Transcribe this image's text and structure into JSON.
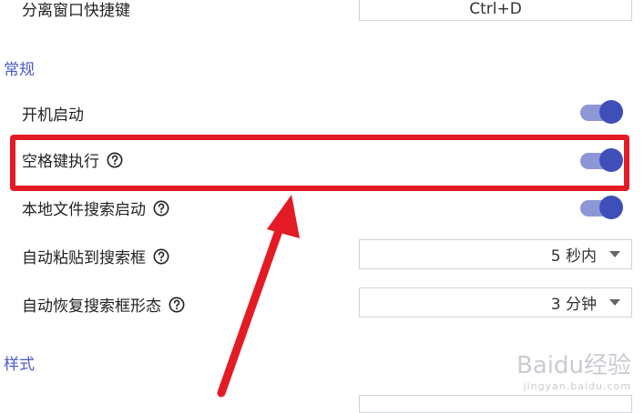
{
  "hotkey_row": {
    "label": "分离窗口快捷键",
    "value": "Ctrl+D"
  },
  "general": {
    "title": "常规",
    "rows": [
      {
        "label": "开机启动",
        "toggle": true
      },
      {
        "label": "空格键执行",
        "toggle": true,
        "help": true,
        "highlighted": true
      },
      {
        "label": "本地文件搜索启动",
        "toggle": true,
        "help": true
      },
      {
        "label": "自动粘贴到搜索框",
        "select_value": "5 秒内",
        "help": true
      },
      {
        "label": "自动恢复搜索框形态",
        "select_value": "3 分钟",
        "help": true
      }
    ]
  },
  "style": {
    "title": "样式"
  },
  "colors": {
    "accent": "#3f4fb9",
    "highlight": "#e31b25",
    "arrow": "#e31b25",
    "section": "#4a5cc4"
  },
  "watermark": {
    "main": "Baidu经验",
    "sub": "jingyan.baidu.com"
  }
}
